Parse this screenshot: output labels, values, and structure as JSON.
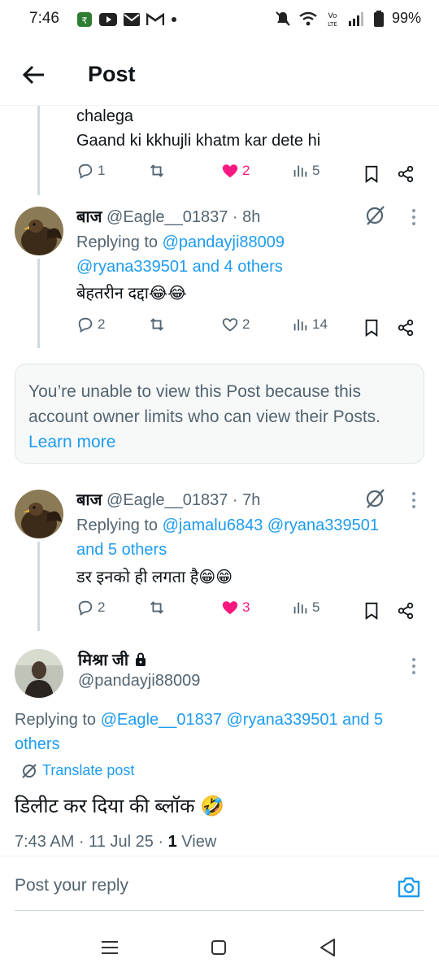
{
  "status_bar": {
    "time": "7:46",
    "battery": "99%",
    "left_icons": [
      "app-icon",
      "youtube-icon",
      "mail-icon",
      "gmail-icon",
      "dot-icon"
    ],
    "right_icons": [
      "mute-icon",
      "wifi-icon",
      "volte-icon",
      "signal-icon",
      "battery-icon"
    ]
  },
  "header": {
    "title": "Post"
  },
  "post1": {
    "text_line1": "chalega",
    "text_line2": "Gaand ki kkhujli khatm kar dete hi",
    "replies": "1",
    "likes": "2",
    "views": "5"
  },
  "post2": {
    "name": "बाज",
    "handle": "@Eagle__01837",
    "time": "· 8h",
    "replying_prefix": "Replying to",
    "replying_line1": "@pandayji88009",
    "replying_line2": "@ryana339501 and 4 others",
    "text": "बेहतरीन दद्दा😂😂",
    "replies": "2",
    "likes": "2",
    "views": "14"
  },
  "notice": {
    "text": "You’re unable to view this Post because this account owner limits who can view their Posts.",
    "link": "Learn more"
  },
  "post3": {
    "name": "बाज",
    "handle": "@Eagle__01837",
    "time": "· 7h",
    "replying_prefix": "Replying to",
    "replying_line1": "@jamalu6843 @ryana339501",
    "replying_line2": "and 5 others",
    "text": "डर इनको ही लगता है😁😁",
    "replies": "2",
    "likes": "3",
    "views": "5"
  },
  "main_post": {
    "name": "मिश्रा जी",
    "handle": "@pandayji88009",
    "replying_prefix": "Replying to",
    "replying_mentions": "@Eagle__01837 @ryana339501 and 5",
    "replying_line2": "others",
    "translate": "Translate post",
    "text": "डिलीट कर दिया की ब्लॉक 🤣",
    "timestamp": "7:43 AM · 11 Jul 25 · ",
    "view_count": "1",
    "view_label": " View"
  },
  "reply_bar": {
    "placeholder": "Post your reply"
  },
  "colors": {
    "link": "#1d9bf0",
    "like": "#f91880",
    "muted": "#536471",
    "text": "#0f1419"
  }
}
